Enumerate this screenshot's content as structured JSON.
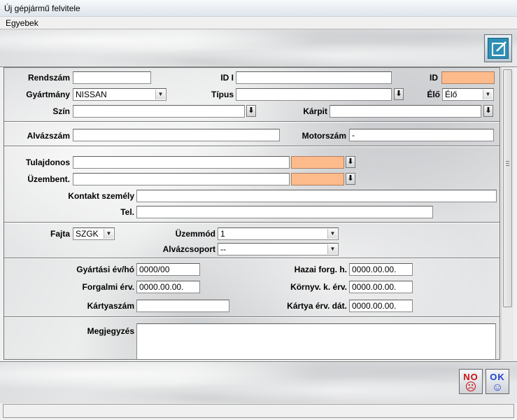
{
  "window": {
    "title": "Új gépjármű felvitele"
  },
  "menu": {
    "items": [
      "Egyebek"
    ]
  },
  "form": {
    "rendszam": {
      "label": "Rendszám",
      "value": ""
    },
    "idi": {
      "label": "ID I",
      "value": ""
    },
    "id": {
      "label": "ID",
      "value": ""
    },
    "gyartmany": {
      "label": "Gyártmány",
      "value": "NISSAN"
    },
    "tipus": {
      "label": "Típus",
      "value": ""
    },
    "elo": {
      "label": "Élő",
      "value": "Élő"
    },
    "szin": {
      "label": "Szín",
      "value": ""
    },
    "karpit": {
      "label": "Kárpit",
      "value": ""
    },
    "alvazszam": {
      "label": "Alvázszám",
      "value": ""
    },
    "motorszam": {
      "label": "Motorszám",
      "value": "-"
    },
    "tulajdonos": {
      "label": "Tulajdonos",
      "value": ""
    },
    "uzembent": {
      "label": "Üzembent.",
      "value": ""
    },
    "kontakt": {
      "label": "Kontakt személy",
      "value": ""
    },
    "tel": {
      "label": "Tel.",
      "value": ""
    },
    "fajta": {
      "label": "Fajta",
      "value": "SZGK"
    },
    "uzemmod": {
      "label": "Üzemmód",
      "value": "1"
    },
    "alvazcsoport": {
      "label": "Alvázcsoport",
      "value": "--"
    },
    "gyartasi": {
      "label": "Gyártási év/hó",
      "value": "0000/00"
    },
    "hazai": {
      "label": "Hazai forg. h.",
      "value": "0000.00.00."
    },
    "forgalmi": {
      "label": "Forgalmi érv.",
      "value": "0000.00.00."
    },
    "kornyv": {
      "label": "Környv. k. érv.",
      "value": "0000.00.00."
    },
    "kartyaszam": {
      "label": "Kártyaszám",
      "value": ""
    },
    "kartya_erv": {
      "label": "Kártya érv. dát.",
      "value": "0000.00.00."
    },
    "megjegyzes": {
      "label": "Megjegyzés",
      "value": ""
    }
  },
  "buttons": {
    "no": {
      "label": "NO",
      "face": "☹"
    },
    "ok": {
      "label": "OK",
      "face": "☺"
    }
  },
  "colors": {
    "highlight_field": "#fdbb8c",
    "ok_text": "#1f3fcf",
    "no_text": "#cc1010"
  },
  "status": {
    "text": ""
  }
}
